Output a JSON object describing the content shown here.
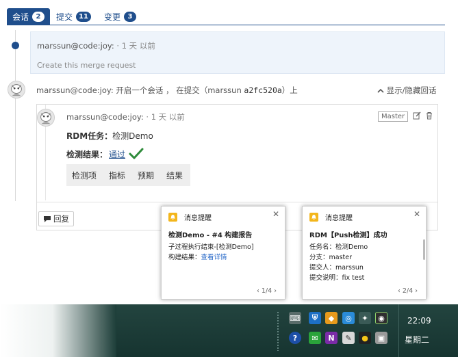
{
  "tabs": [
    {
      "label": "会话",
      "count": "2"
    },
    {
      "label": "提交",
      "count": "11"
    },
    {
      "label": "变更",
      "count": "3"
    }
  ],
  "event": {
    "user": "marssun@code:joy:",
    "time": "· 1 天 以前",
    "description": "Create this merge request"
  },
  "discussion": {
    "user": "marssun@code:joy:",
    "text_prefix": "开启一个会话 ， 在提交（",
    "commit_author": "marssun",
    "commit_hash": "a2fc520a",
    "text_suffix": "）上",
    "toggle_label": "显示/隐藏回话"
  },
  "comment": {
    "user": "marssun@code:joy:",
    "time": "· 1 天 以前",
    "branch_tag": "Master",
    "task_label": "RDM任务：",
    "task_value": "检测Demo",
    "result_label": "检测结果：",
    "result_value": "通过",
    "table_headers": [
      "检测项",
      "指标",
      "预期",
      "结果"
    ],
    "reply_label": "回复"
  },
  "notifications": [
    {
      "header": "消息提醒",
      "title": "检测Demo - #4 构建报告",
      "lines": [
        "子过程执行结束-[检测Demo]"
      ],
      "link_prefix": "构建结果：",
      "link_text": "查看详情",
      "pager": "1/4"
    },
    {
      "header": "消息提醒",
      "title": "RDM【Push检测】成功",
      "lines": [
        "任务名：检测Demo",
        "分支：master",
        "提交人：marssun",
        "提交说明：fix test"
      ],
      "pager": "2/4"
    }
  ],
  "taskbar": {
    "time": "22:09",
    "weekday": "星期二"
  },
  "colors": {
    "accent": "#1f4e8c",
    "check": "#2e8b3a",
    "bell": "#f3b61c",
    "taskbar": "#1c3d38"
  }
}
